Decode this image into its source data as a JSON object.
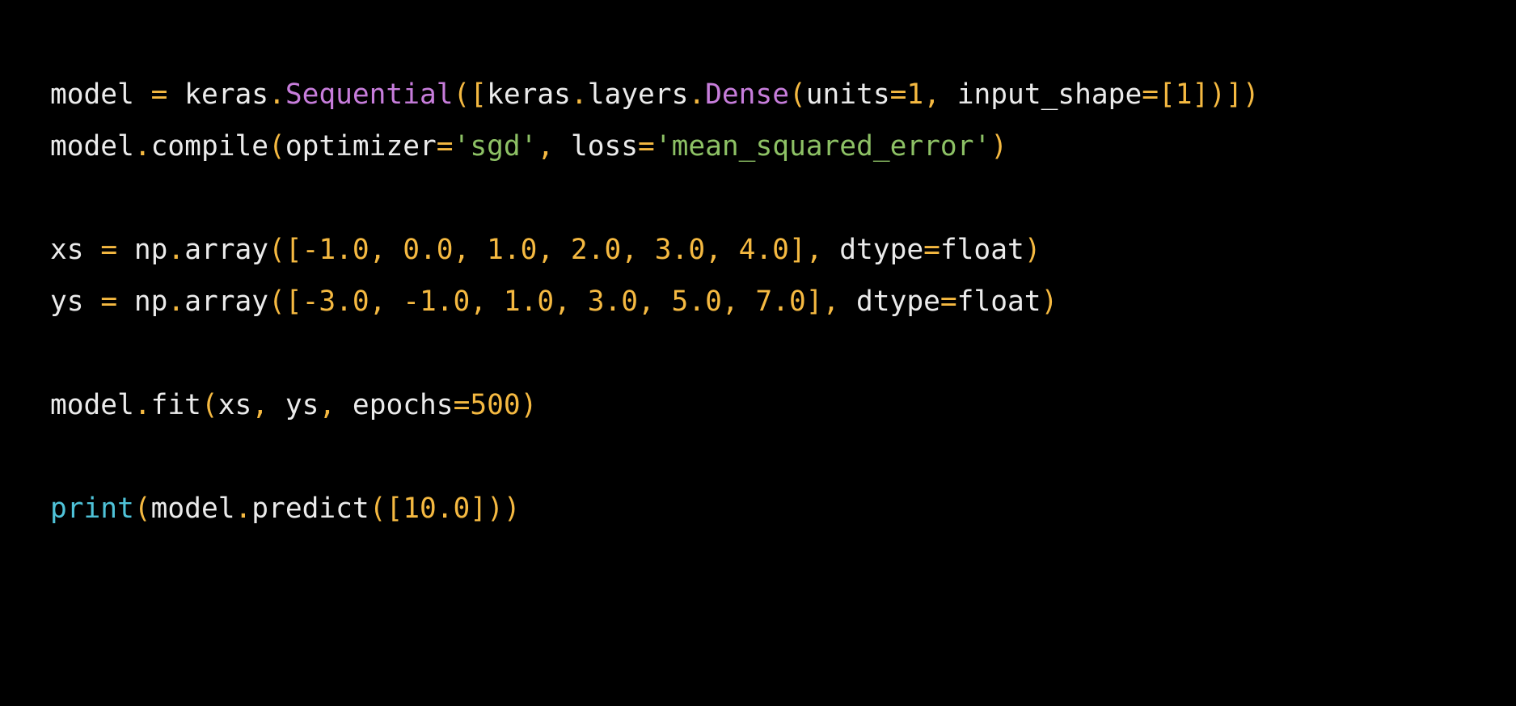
{
  "colors": {
    "background": "#000000",
    "default": "#ebebeb",
    "builtin": "#4fc3d9",
    "function": "#c77ddb",
    "number": "#f5b941",
    "string": "#8dc165",
    "punctuation": "#f5b941"
  },
  "code": {
    "lines": [
      {
        "tokens": [
          {
            "t": "model ",
            "c": "plain"
          },
          {
            "t": "=",
            "c": "punc"
          },
          {
            "t": " keras",
            "c": "plain"
          },
          {
            "t": ".",
            "c": "punc"
          },
          {
            "t": "Sequential",
            "c": "fn"
          },
          {
            "t": "([",
            "c": "punc"
          },
          {
            "t": "keras",
            "c": "plain"
          },
          {
            "t": ".",
            "c": "punc"
          },
          {
            "t": "layers",
            "c": "plain"
          },
          {
            "t": ".",
            "c": "punc"
          },
          {
            "t": "Dense",
            "c": "fn"
          },
          {
            "t": "(",
            "c": "punc"
          },
          {
            "t": "units",
            "c": "plain"
          },
          {
            "t": "=",
            "c": "punc"
          },
          {
            "t": "1",
            "c": "num"
          },
          {
            "t": ",",
            "c": "punc"
          },
          {
            "t": " input_shape",
            "c": "plain"
          },
          {
            "t": "=",
            "c": "punc"
          },
          {
            "t": "[1])])",
            "c": "num"
          }
        ]
      },
      {
        "tokens": [
          {
            "t": "model",
            "c": "plain"
          },
          {
            "t": ".",
            "c": "punc"
          },
          {
            "t": "compile",
            "c": "plain"
          },
          {
            "t": "(",
            "c": "punc"
          },
          {
            "t": "optimizer",
            "c": "plain"
          },
          {
            "t": "=",
            "c": "punc"
          },
          {
            "t": "'sgd'",
            "c": "str"
          },
          {
            "t": ",",
            "c": "punc"
          },
          {
            "t": " loss",
            "c": "plain"
          },
          {
            "t": "=",
            "c": "punc"
          },
          {
            "t": "'mean_squared_error'",
            "c": "str"
          },
          {
            "t": ")",
            "c": "punc"
          }
        ]
      },
      {
        "tokens": []
      },
      {
        "tokens": [
          {
            "t": "xs ",
            "c": "plain"
          },
          {
            "t": "=",
            "c": "punc"
          },
          {
            "t": " np",
            "c": "plain"
          },
          {
            "t": ".",
            "c": "punc"
          },
          {
            "t": "array",
            "c": "plain"
          },
          {
            "t": "([-1.0, 0.0, 1.0, 2.0, 3.0, 4.0],",
            "c": "num"
          },
          {
            "t": " dtype",
            "c": "plain"
          },
          {
            "t": "=",
            "c": "punc"
          },
          {
            "t": "float",
            "c": "plain"
          },
          {
            "t": ")",
            "c": "punc"
          }
        ]
      },
      {
        "tokens": [
          {
            "t": "ys ",
            "c": "plain"
          },
          {
            "t": "=",
            "c": "punc"
          },
          {
            "t": " np",
            "c": "plain"
          },
          {
            "t": ".",
            "c": "punc"
          },
          {
            "t": "array",
            "c": "plain"
          },
          {
            "t": "([-3.0, -1.0, 1.0, 3.0, 5.0, 7.0],",
            "c": "num"
          },
          {
            "t": " dtype",
            "c": "plain"
          },
          {
            "t": "=",
            "c": "punc"
          },
          {
            "t": "float",
            "c": "plain"
          },
          {
            "t": ")",
            "c": "punc"
          }
        ]
      },
      {
        "tokens": []
      },
      {
        "tokens": [
          {
            "t": "model",
            "c": "plain"
          },
          {
            "t": ".",
            "c": "punc"
          },
          {
            "t": "fit",
            "c": "plain"
          },
          {
            "t": "(",
            "c": "punc"
          },
          {
            "t": "xs",
            "c": "plain"
          },
          {
            "t": ",",
            "c": "punc"
          },
          {
            "t": " ys",
            "c": "plain"
          },
          {
            "t": ",",
            "c": "punc"
          },
          {
            "t": " epochs",
            "c": "plain"
          },
          {
            "t": "=",
            "c": "punc"
          },
          {
            "t": "500",
            "c": "num"
          },
          {
            "t": ")",
            "c": "punc"
          }
        ]
      },
      {
        "tokens": []
      },
      {
        "tokens": [
          {
            "t": "print",
            "c": "kw"
          },
          {
            "t": "(",
            "c": "punc"
          },
          {
            "t": "model",
            "c": "plain"
          },
          {
            "t": ".",
            "c": "punc"
          },
          {
            "t": "predict",
            "c": "plain"
          },
          {
            "t": "([10.0]))",
            "c": "num"
          }
        ]
      }
    ]
  }
}
